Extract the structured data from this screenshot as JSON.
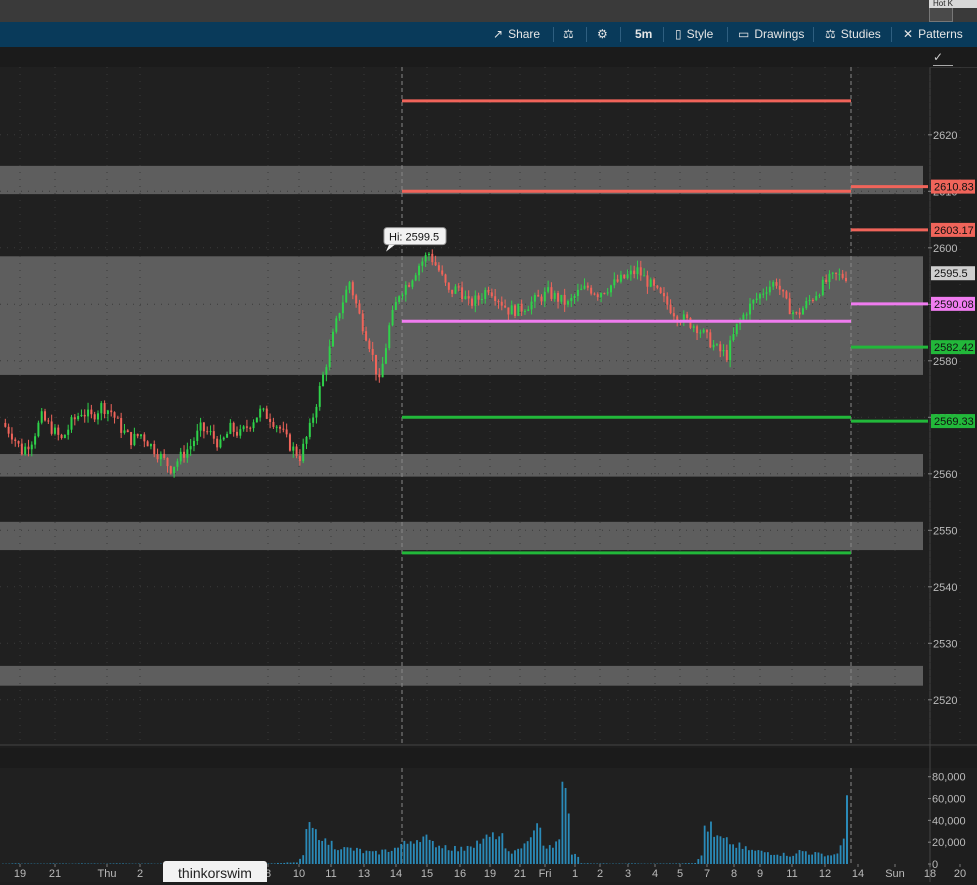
{
  "topstrip": {
    "tab_text": "Hot K"
  },
  "toolbar": {
    "share": "Share",
    "timeframe": "5m",
    "style": "Style",
    "drawings": "Drawings",
    "studies": "Studies",
    "patterns": "Patterns",
    "icons": [
      "share-icon",
      "flask-icon",
      "gear-icon",
      "candle-icon",
      "rect-icon",
      "flask-icon",
      "pattern-icon"
    ]
  },
  "brand": {
    "label": "thinkorswim"
  },
  "colors": {
    "bg": "#1e1e1e",
    "zone": "#6a6a6a",
    "red_line": "#f0645a",
    "green_line": "#22b83a",
    "magenta_line": "#f07cf0",
    "candle_up": "#2fd24a",
    "candle_down": "#f0645a",
    "volume": "#2a8ab8"
  },
  "chart_data": {
    "type": "candlestick",
    "price_axis": {
      "ylim": [
        2512,
        2632
      ],
      "ticks": [
        2520,
        2530,
        2540,
        2550,
        2560,
        2570,
        2580,
        2590,
        2600,
        2610,
        2620
      ]
    },
    "volume_axis": {
      "ylim": [
        0,
        88000
      ],
      "tick_labels": [
        "0",
        "20,000",
        "40,000",
        "60,000",
        "80,000"
      ],
      "tick_values": [
        0,
        20000,
        40000,
        60000,
        80000
      ]
    },
    "x_labels": [
      "19",
      "21",
      "Thu",
      "2",
      "8",
      "10",
      "11",
      "13",
      "14",
      "15",
      "16",
      "19",
      "21",
      "Fri",
      "1",
      "2",
      "3",
      "4",
      "5",
      "7",
      "8",
      "9",
      "11",
      "12",
      "14",
      "Sun",
      "18",
      "20"
    ],
    "zones": [
      {
        "low": 2609.5,
        "high": 2614.5
      },
      {
        "low": 2577.5,
        "high": 2598.5
      },
      {
        "low": 2559.5,
        "high": 2563.5
      },
      {
        "low": 2546.5,
        "high": 2551.5
      },
      {
        "low": 2522.5,
        "high": 2526.0
      }
    ],
    "horizontal_lines": [
      {
        "price": 2626.0,
        "color": "red",
        "segment": "session"
      },
      {
        "price": 2610.0,
        "color": "red",
        "segment": "session"
      },
      {
        "price": 2587.0,
        "color": "magenta",
        "segment": "session"
      },
      {
        "price": 2570.0,
        "color": "green",
        "segment": "session"
      },
      {
        "price": 2546.0,
        "color": "green",
        "segment": "session"
      },
      {
        "price": 2610.83,
        "color": "red",
        "segment": "future"
      },
      {
        "price": 2603.17,
        "color": "red",
        "segment": "future"
      },
      {
        "price": 2590.08,
        "color": "magenta",
        "segment": "future"
      },
      {
        "price": 2582.42,
        "color": "green",
        "segment": "future"
      },
      {
        "price": 2569.33,
        "color": "green",
        "segment": "future"
      }
    ],
    "price_labels": [
      {
        "text": "2610.83",
        "value": 2610.83,
        "color": "red"
      },
      {
        "text": "2603.17",
        "value": 2603.17,
        "color": "red"
      },
      {
        "text": "2595.5",
        "value": 2595.5,
        "color": "gray"
      },
      {
        "text": "2590.08",
        "value": 2590.08,
        "color": "magenta"
      },
      {
        "text": "2582.42",
        "value": 2582.42,
        "color": "green"
      },
      {
        "text": "2569.33",
        "value": 2569.33,
        "color": "green"
      }
    ],
    "high_bubble": {
      "text": "Hi: 2599.5",
      "value": 2599.5
    },
    "close_path": [
      2569,
      2567,
      2564,
      2566,
      2570,
      2568,
      2566,
      2569,
      2571,
      2570,
      2572,
      2571,
      2568,
      2566,
      2567,
      2565,
      2563,
      2561,
      2563,
      2565,
      2568,
      2567,
      2565,
      2568,
      2567,
      2569,
      2571,
      2570,
      2568,
      2565,
      2563,
      2568,
      2575,
      2582,
      2589,
      2594,
      2588,
      2583,
      2576,
      2586,
      2592,
      2594,
      2597,
      2599,
      2596,
      2592,
      2593,
      2590,
      2591,
      2593,
      2591,
      2589,
      2589,
      2590,
      2591,
      2592,
      2591,
      2590,
      2592,
      2593,
      2592,
      2593,
      2594,
      2595,
      2596,
      2594,
      2592,
      2590,
      2588,
      2587,
      2586,
      2584,
      2582,
      2581,
      2586,
      2589,
      2591,
      2593,
      2594,
      2590,
      2588,
      2590,
      2592,
      2594,
      2595,
      2595
    ],
    "volume_profile": [
      300,
      500,
      400,
      400,
      300,
      500,
      400,
      300,
      500,
      400,
      300,
      400,
      500,
      400,
      300,
      400,
      300,
      300,
      400,
      500,
      300,
      400,
      300,
      400,
      300,
      500,
      400,
      300,
      500,
      800,
      1200,
      1500,
      33000,
      28000,
      20000,
      16000,
      14000,
      13000,
      11000,
      10000,
      12000,
      14000,
      18000,
      22000,
      25000,
      19000,
      17000,
      15000,
      13000,
      18000,
      20000,
      24000,
      27000,
      12000,
      11000,
      22000,
      34000,
      16000,
      14000,
      68000,
      9000,
      600,
      400,
      500,
      300,
      400,
      500,
      400,
      300,
      500,
      400,
      600,
      800,
      1000,
      35000,
      24000,
      21000,
      17000,
      14000,
      12000,
      11000,
      10000,
      9000,
      8000,
      12000,
      10000,
      9000,
      8000,
      11000,
      63000
    ]
  }
}
